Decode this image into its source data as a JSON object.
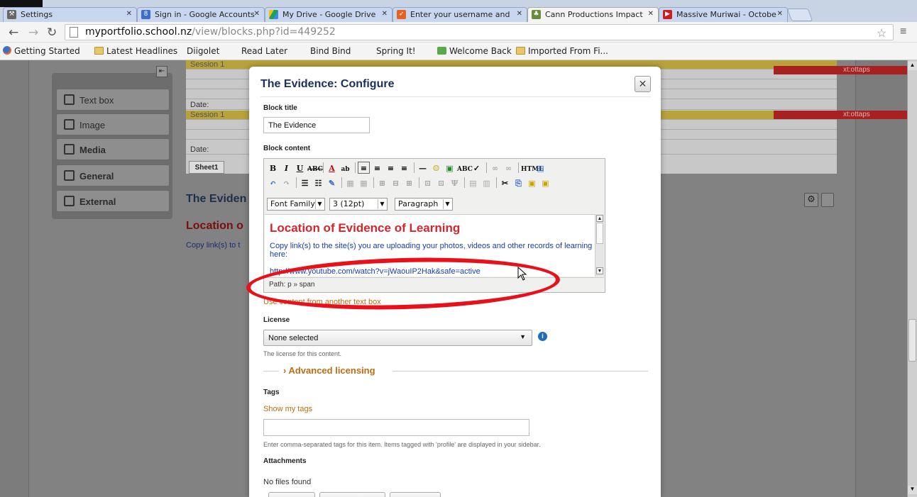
{
  "browser": {
    "tabs": [
      {
        "title": "Settings",
        "active": false
      },
      {
        "title": "Sign in - Google Accounts",
        "active": false
      },
      {
        "title": "My Drive - Google Drive",
        "active": false
      },
      {
        "title": "Enter your username and",
        "active": false
      },
      {
        "title": "Cann Productions Impact",
        "active": true
      },
      {
        "title": "Massive Muriwai - Octobe",
        "active": false
      }
    ],
    "url_host": "myportfolio.school.nz",
    "url_path": "/view/blocks.php?id=449252",
    "bookmarks": [
      {
        "label": "Getting Started",
        "icon": "firefox-icon"
      },
      {
        "label": "Latest Headlines",
        "icon": "folder-icon"
      },
      {
        "label": "Diigolet",
        "icon": "page-icon"
      },
      {
        "label": "Read Later",
        "icon": "page-icon"
      },
      {
        "label": "Bind Bind",
        "icon": "page-icon"
      },
      {
        "label": "Spring It!",
        "icon": "page-icon"
      },
      {
        "label": "Welcome Back",
        "icon": "green-icon"
      },
      {
        "label": "Imported From Fi...",
        "icon": "folder-icon"
      }
    ]
  },
  "background": {
    "palette_items": [
      "Text box",
      "Image",
      "Media",
      "General",
      "External"
    ],
    "sheet_rows": [
      "Session 1",
      "",
      "Date:",
      "Session 1",
      "",
      "Date:"
    ],
    "red_cell_text": "xt:ottaps",
    "sheet_tab": "Sheet1",
    "block_heading": "The Eviden",
    "block_location": "Location o",
    "block_copy": "Copy link(s) to t"
  },
  "modal": {
    "title": "The Evidence: Configure",
    "close_symbol": "✕",
    "block_title_label": "Block title",
    "block_title_value": "The Evidence",
    "block_content_label": "Block content",
    "font_family": "Font Family",
    "font_size": "3 (12pt)",
    "format": "Paragraph",
    "content_heading": "Location of Evidence of Learning",
    "content_paragraph": "Copy link(s) to the site(s) you are uploading your photos, videos and other records of learning here:",
    "content_url": "http://www.youtube.com/watch?v=jWaouIP2Hak&safe=active",
    "path_label": "Path: p » span",
    "use_content_link": "Use content from another text box",
    "license_label": "License",
    "license_value": "None selected",
    "license_hint": "The license for this content.",
    "advanced_licensing": "Advanced licensing",
    "tags_label": "Tags",
    "show_tags": "Show my tags",
    "tags_hint": "Enter comma-separated tags for this item. Items tagged with 'profile' are displayed in your sidebar.",
    "attachments_label": "Attachments",
    "no_files": "No files found"
  },
  "colors": {
    "annotation_ellipse": "#e8111a",
    "content_heading": "#d6262c",
    "link_orange": "#c26b12",
    "modal_title": "#1a3160"
  }
}
